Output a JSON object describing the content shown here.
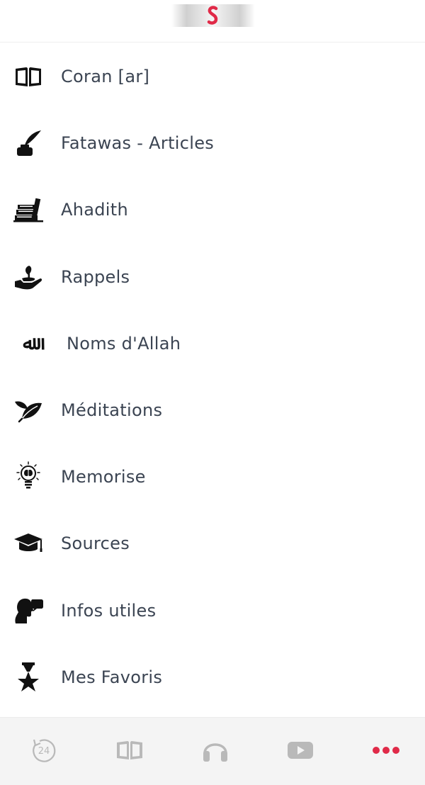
{
  "header": {
    "logo_icon": "s-logo-icon",
    "accent_color": "#e02a48"
  },
  "menu": {
    "items": [
      {
        "label": "Coran [ar]",
        "icon": "open-book-icon"
      },
      {
        "label": "Fatawas - Articles",
        "icon": "quill-inkwell-icon"
      },
      {
        "label": "Ahadith",
        "icon": "books-stack-icon"
      },
      {
        "label": "Rappels",
        "icon": "hand-plant-icon"
      },
      {
        "label": "Noms d'Allah",
        "icon": "allah-calligraphy-icon",
        "glyph": "ﷲ"
      },
      {
        "label": "Méditations",
        "icon": "leaf-icon"
      },
      {
        "label": "Memorise",
        "icon": "brain-bulb-icon"
      },
      {
        "label": "Sources",
        "icon": "graduation-cap-icon"
      },
      {
        "label": "Infos utiles",
        "icon": "head-speech-icon"
      },
      {
        "label": "Mes Favoris",
        "icon": "star-medal-icon"
      }
    ]
  },
  "tabbar": {
    "tabs": [
      {
        "icon": "replay-24-icon",
        "text": "24"
      },
      {
        "icon": "book-tab-icon"
      },
      {
        "icon": "headphones-icon"
      },
      {
        "icon": "youtube-icon"
      },
      {
        "icon": "more-dots-icon",
        "active": true
      }
    ],
    "inactive_color": "#b9b9b9",
    "active_color": "#e02a48"
  }
}
